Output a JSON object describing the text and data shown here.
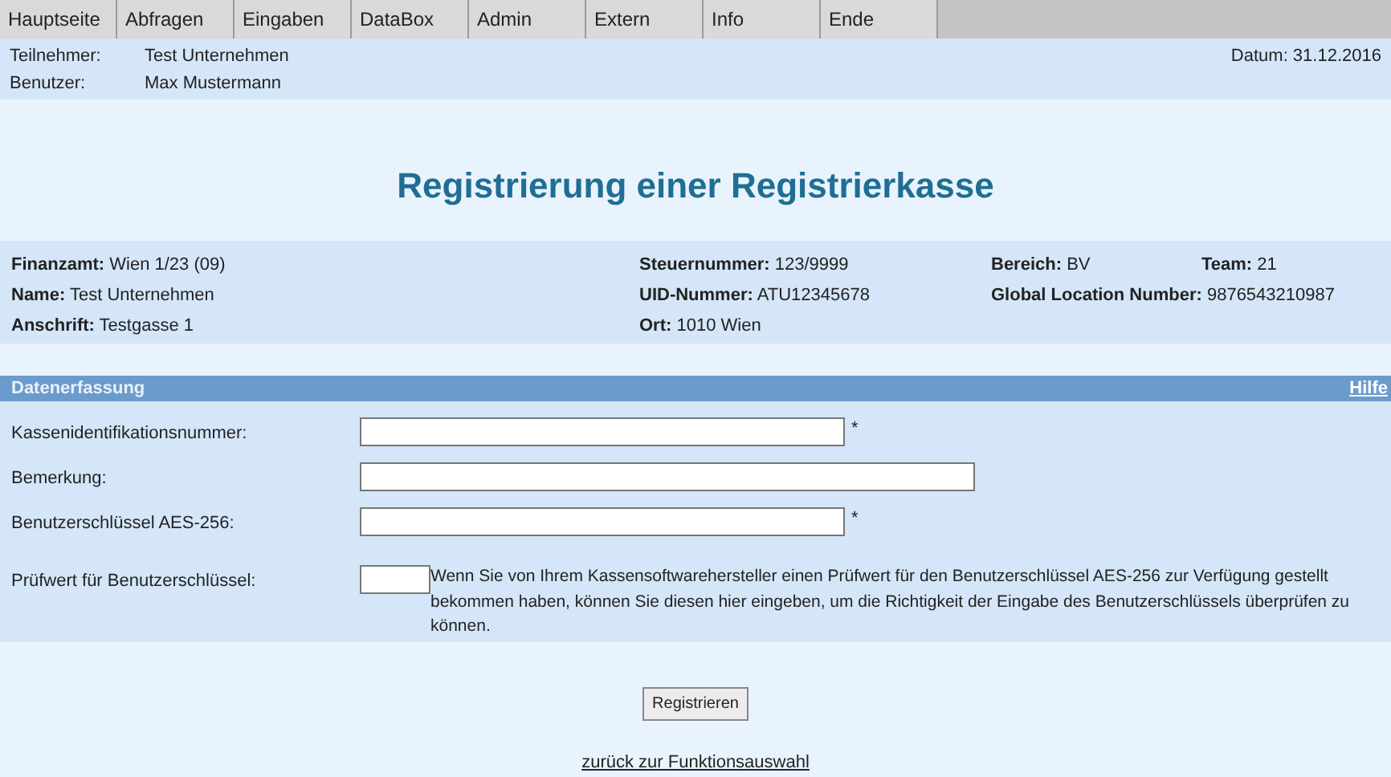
{
  "menu": [
    {
      "label": "Hauptseite"
    },
    {
      "label": "Abfragen"
    },
    {
      "label": "Eingaben"
    },
    {
      "label": "DataBox"
    },
    {
      "label": "Admin"
    },
    {
      "label": "Extern"
    },
    {
      "label": "Info"
    },
    {
      "label": "Ende"
    }
  ],
  "header": {
    "rows": [
      {
        "label": "Teilnehmer:",
        "value": "Test Unternehmen"
      },
      {
        "label": "Benutzer:",
        "value": "Max Mustermann"
      }
    ],
    "date": "Datum: 31.12.2016"
  },
  "title": "Registrierung einer Registrierkasse",
  "info": [
    [
      {
        "label": "Finanzamt:",
        "value": "Wien 1/23  (09)"
      },
      {
        "label": "Steuernummer:",
        "value": "123/9999"
      },
      {
        "label": "Bereich:",
        "value": "BV"
      },
      {
        "label": "Team:",
        "value": "21"
      }
    ],
    [
      {
        "label": "Name:",
        "value": "Test Unternehmen"
      },
      {
        "label": "UID-Nummer:",
        "value": "ATU12345678"
      },
      {
        "label": "Global Location Number:",
        "value": "9876543210987"
      }
    ],
    [
      {
        "label": "Anschrift:",
        "value": "Testgasse 1"
      },
      {
        "label": "Ort:",
        "value": "1010 Wien"
      }
    ]
  ],
  "section": {
    "title": "Datenerfassung",
    "help": "Hilfe"
  },
  "fields": [
    {
      "label": "Kassenidentifikationsnummer:",
      "kind": "medium",
      "marker": "*"
    },
    {
      "label": "Bemerkung:",
      "kind": "wide"
    },
    {
      "label": "Benutzerschlüssel AES-256:",
      "kind": "medium",
      "marker": "*"
    },
    {
      "label": "Prüfwert für Benutzerschlüssel:",
      "kind": "short",
      "hint": "Wenn Sie von Ihrem Kassensoftwarehersteller einen Prüfwert für den Benutzerschlüssel AES-256 zur Verfügung gestellt bekommen haben, können Sie diesen hier eingeben, um die Richtigkeit der Eingabe des Benutzerschlüssels überprüfen zu können."
    }
  ],
  "submit": "Registrieren",
  "back_link": "zurück zur Funktionsauswahl"
}
